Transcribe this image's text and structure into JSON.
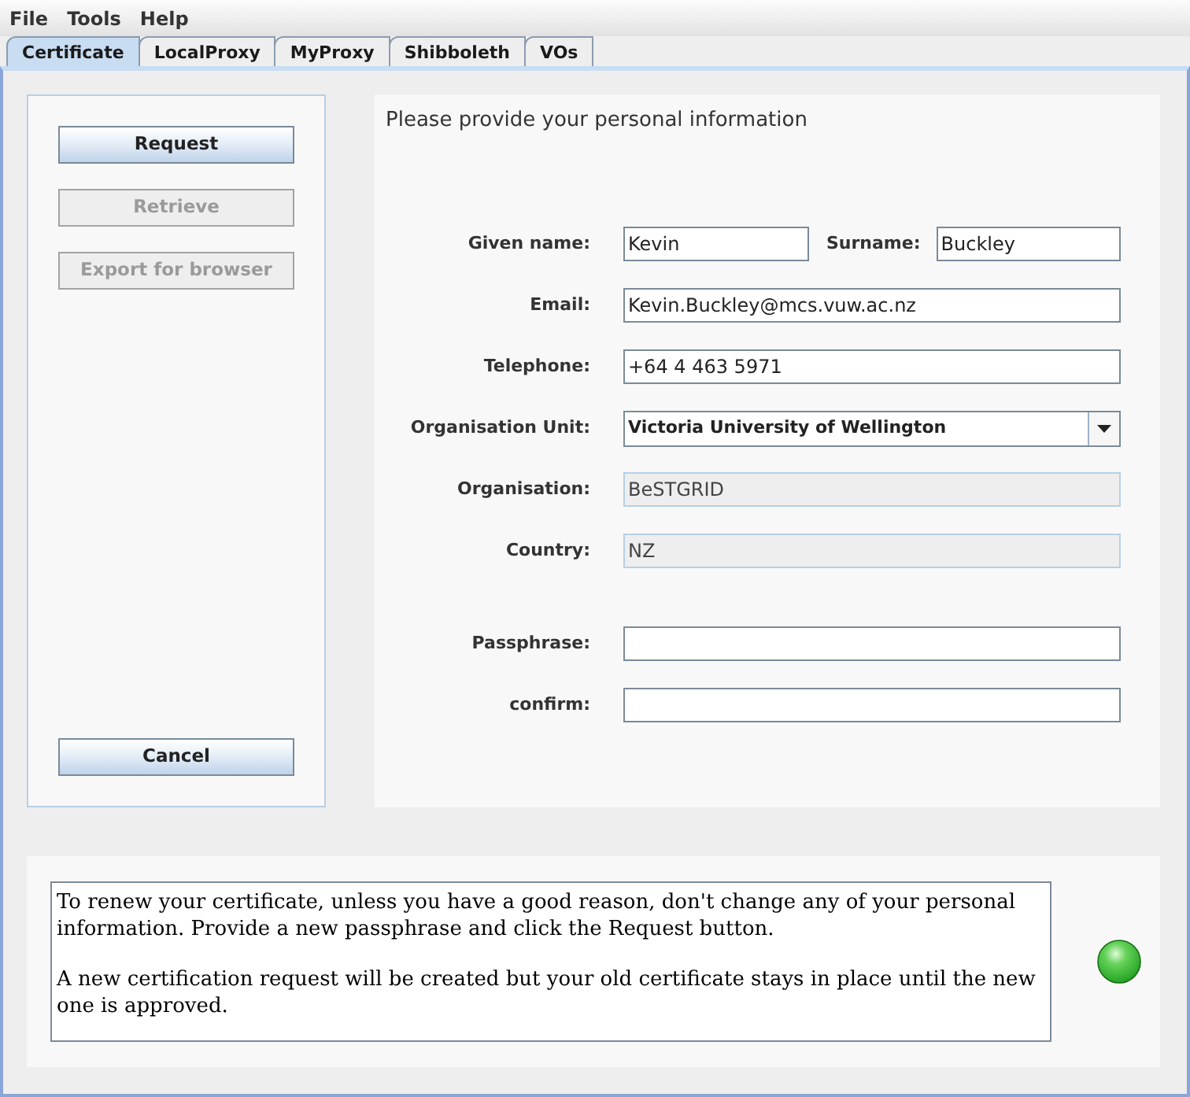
{
  "menu": [
    {
      "label": "File"
    },
    {
      "label": "Tools"
    },
    {
      "label": "Help"
    }
  ],
  "tabs": [
    {
      "label": "Certificate",
      "selected": true
    },
    {
      "label": "LocalProxy",
      "selected": false
    },
    {
      "label": "MyProxy",
      "selected": false
    },
    {
      "label": "Shibboleth",
      "selected": false
    },
    {
      "label": "VOs",
      "selected": false
    }
  ],
  "side_panel": {
    "buttons": [
      {
        "label": "Request",
        "disabled": false
      },
      {
        "label": "Retrieve",
        "disabled": true
      },
      {
        "label": "Export for browser",
        "disabled": true
      }
    ],
    "cancel": {
      "label": "Cancel",
      "disabled": false
    }
  },
  "form": {
    "title": "Please provide your personal information",
    "sections": [
      {
        "rows": [
          {
            "fields": [
              {
                "label": "Given name:",
                "kind": "text",
                "value": "Kevin",
                "disabled": false
              },
              {
                "label": "Surname:",
                "kind": "text",
                "value": "Buckley",
                "disabled": false
              }
            ]
          },
          {
            "fields": [
              {
                "label": "Email:",
                "kind": "text",
                "value": "Kevin.Buckley@mcs.vuw.ac.nz",
                "disabled": false
              }
            ]
          },
          {
            "fields": [
              {
                "label": "Telephone:",
                "kind": "text",
                "value": "+64 4 463 5971",
                "disabled": false
              }
            ]
          },
          {
            "fields": [
              {
                "label": "Organisation Unit:",
                "kind": "combo",
                "value": "Victoria University of Wellington"
              }
            ]
          },
          {
            "fields": [
              {
                "label": "Organisation:",
                "kind": "text",
                "value": "BeSTGRID",
                "disabled": true
              }
            ]
          },
          {
            "fields": [
              {
                "label": "Country:",
                "kind": "text",
                "value": "NZ",
                "disabled": true
              }
            ]
          }
        ]
      },
      {
        "rows": [
          {
            "fields": [
              {
                "label": "Passphrase:",
                "kind": "password",
                "disabled": false
              }
            ]
          },
          {
            "fields": [
              {
                "label": "confirm:",
                "kind": "password",
                "disabled": false
              }
            ]
          }
        ]
      }
    ]
  },
  "info": {
    "paragraphs": [
      "To renew your certificate, unless you have a good reason, don't change any of your personal information. Provide a new passphrase and click the Request button.",
      "A new certification request will be created but your old certificate stays in place until the new one is approved."
    ]
  },
  "status_light": {
    "on": true
  }
}
